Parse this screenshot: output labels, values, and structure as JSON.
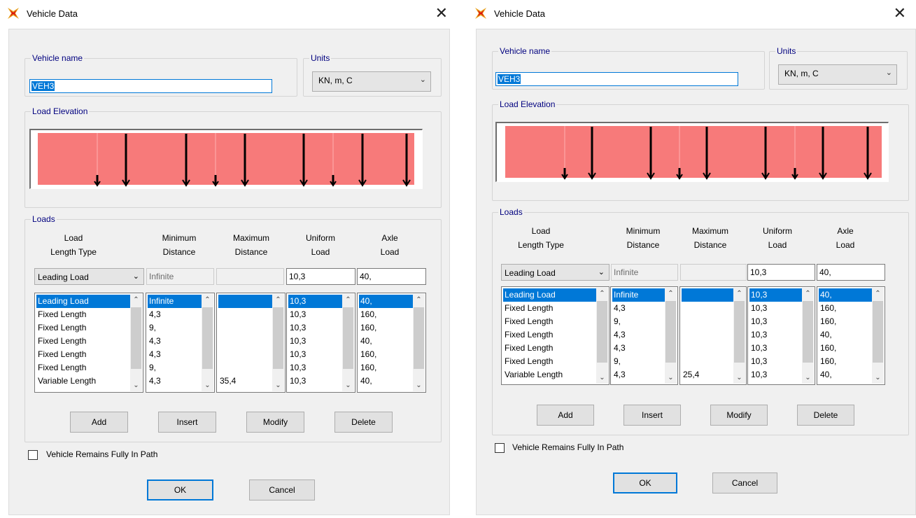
{
  "dialogs": [
    {
      "title": "Vehicle Data",
      "vehicle_name_label": "Vehicle name",
      "vehicle_name_value": "VEH3",
      "units_label": "Units",
      "units_value": "KN, m, C",
      "load_elevation_label": "Load Elevation",
      "loads_label": "Loads",
      "headers": {
        "load_length_type": [
          "Load",
          "Length Type"
        ],
        "minimum_distance": [
          "Minimum",
          "Distance"
        ],
        "maximum_distance": [
          "Maximum",
          "Distance"
        ],
        "uniform_load": [
          "Uniform",
          "Load"
        ],
        "axle_load": [
          "Axle",
          "Load"
        ]
      },
      "edit_row": {
        "load_length_type": "Leading Load",
        "minimum_distance": "Infinite",
        "maximum_distance": "",
        "uniform_load": "10,3",
        "axle_load": "40,"
      },
      "lists": {
        "load_length_type": [
          "Leading Load",
          "Fixed Length",
          "Fixed Length",
          "Fixed Length",
          "Fixed Length",
          "Fixed Length",
          "Variable Length"
        ],
        "minimum_distance": [
          "Infinite",
          "4,3",
          "9,",
          "4,3",
          "4,3",
          "9,",
          "4,3"
        ],
        "maximum_distance": [
          "",
          "",
          "",
          "",
          "",
          "",
          "35,4"
        ],
        "uniform_load": [
          "10,3",
          "10,3",
          "10,3",
          "10,3",
          "10,3",
          "10,3",
          "10,3"
        ],
        "axle_load": [
          "40,",
          "160,",
          "160,",
          "40,",
          "160,",
          "160,",
          "40,"
        ]
      },
      "buttons": {
        "add": "Add",
        "insert": "Insert",
        "modify": "Modify",
        "delete": "Delete",
        "ok": "OK",
        "cancel": "Cancel"
      },
      "checkbox_label": "Vehicle Remains Fully In Path",
      "checkbox_checked": false
    },
    {
      "title": "Vehicle Data",
      "vehicle_name_label": "Vehicle name",
      "vehicle_name_value": "VEH3",
      "units_label": "Units",
      "units_value": "KN, m, C",
      "load_elevation_label": "Load Elevation",
      "loads_label": "Loads",
      "headers": {
        "load_length_type": [
          "Load",
          "Length Type"
        ],
        "minimum_distance": [
          "Minimum",
          "Distance"
        ],
        "maximum_distance": [
          "Maximum",
          "Distance"
        ],
        "uniform_load": [
          "Uniform",
          "Load"
        ],
        "axle_load": [
          "Axle",
          "Load"
        ]
      },
      "edit_row": {
        "load_length_type": "Leading Load",
        "minimum_distance": "Infinite",
        "maximum_distance": "",
        "uniform_load": "10,3",
        "axle_load": "40,"
      },
      "lists": {
        "load_length_type": [
          "Leading Load",
          "Fixed Length",
          "Fixed Length",
          "Fixed Length",
          "Fixed Length",
          "Fixed Length",
          "Variable Length"
        ],
        "minimum_distance": [
          "Infinite",
          "4,3",
          "9,",
          "4,3",
          "4,3",
          "9,",
          "4,3"
        ],
        "maximum_distance": [
          "",
          "",
          "",
          "",
          "",
          "",
          "25,4"
        ],
        "uniform_load": [
          "10,3",
          "10,3",
          "10,3",
          "10,3",
          "10,3",
          "10,3",
          "10,3"
        ],
        "axle_load": [
          "40,",
          "160,",
          "160,",
          "40,",
          "160,",
          "160,",
          "40,"
        ]
      },
      "buttons": {
        "add": "Add",
        "insert": "Insert",
        "modify": "Modify",
        "delete": "Delete",
        "ok": "OK",
        "cancel": "Cancel"
      },
      "checkbox_label": "Vehicle Remains Fully In Path",
      "checkbox_checked": false
    }
  ],
  "colors": {
    "load_fill": "#f77a7a",
    "selection": "#0078d7",
    "group_label": "#00007f"
  },
  "icons": {
    "app": "sap-logo-icon",
    "close": "close-icon"
  }
}
